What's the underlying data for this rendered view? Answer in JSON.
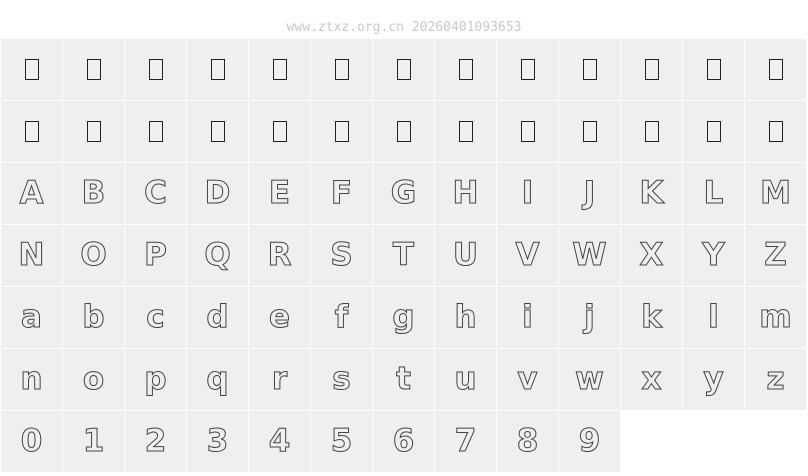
{
  "header": {
    "watermark": "www.ztxz.org.cn 20260401093653"
  },
  "rows": [
    [
      "",
      "",
      "",
      "",
      "",
      "",
      "",
      "",
      "",
      "",
      "",
      "",
      ""
    ],
    [
      "",
      "",
      "",
      "",
      "",
      "",
      "",
      "",
      "",
      "",
      "",
      "",
      ""
    ],
    [
      "A",
      "B",
      "C",
      "D",
      "E",
      "F",
      "G",
      "H",
      "I",
      "J",
      "K",
      "L",
      "M"
    ],
    [
      "N",
      "O",
      "P",
      "Q",
      "R",
      "S",
      "T",
      "U",
      "V",
      "W",
      "X",
      "Y",
      "Z"
    ],
    [
      "a",
      "b",
      "c",
      "d",
      "e",
      "f",
      "g",
      "h",
      "i",
      "j",
      "k",
      "l",
      "m"
    ],
    [
      "n",
      "o",
      "p",
      "q",
      "r",
      "s",
      "t",
      "u",
      "v",
      "w",
      "x",
      "y",
      "z"
    ],
    [
      "0",
      "1",
      "2",
      "3",
      "4",
      "5",
      "6",
      "7",
      "8",
      "9"
    ]
  ],
  "missing_rows": [
    0,
    1
  ]
}
